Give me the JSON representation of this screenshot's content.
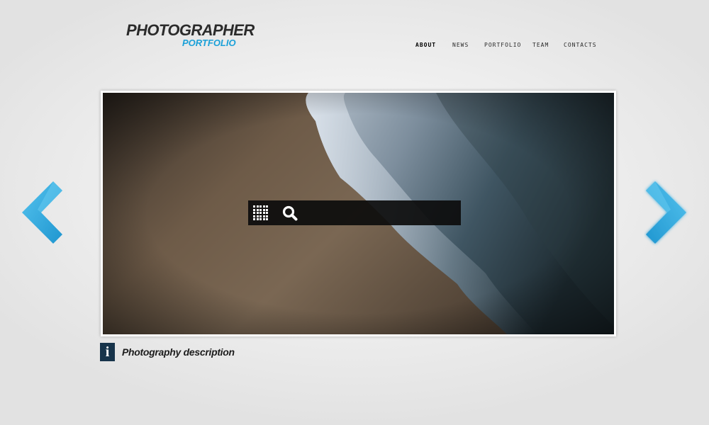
{
  "logo": {
    "title": "PHOTOGRAPHER",
    "subtitle": "PORTFOLIO"
  },
  "nav": {
    "items": [
      {
        "label": "ABOUT",
        "active": true
      },
      {
        "label": "NEWS",
        "active": false
      },
      {
        "label": "PORTFOLIO",
        "active": false
      },
      {
        "label": "TEAM",
        "active": false
      },
      {
        "label": "CONTACTS",
        "active": false
      }
    ]
  },
  "slider": {
    "toolbar": {
      "grid_icon": "grid-icon",
      "search_icon": "search-icon"
    },
    "prev_icon": "chevron-left-icon",
    "next_icon": "chevron-right-icon"
  },
  "caption": {
    "icon": "info-icon",
    "icon_glyph": "i",
    "text": "Photography description"
  },
  "colors": {
    "accent": "#1aa0d8",
    "arrow": "#2ba9e0",
    "info_bg": "#17344b",
    "toolbar_bg": "#0c0c0c"
  }
}
